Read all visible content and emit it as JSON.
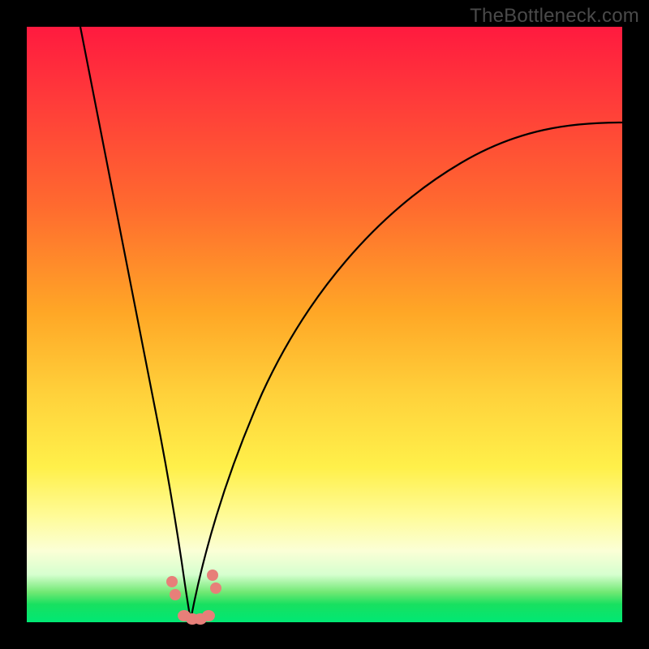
{
  "watermark": "TheBottleneck.com",
  "colors": {
    "background": "#000000",
    "curve": "#000000",
    "marker": "#e77f79"
  },
  "chart_data": {
    "type": "line",
    "title": "",
    "xlabel": "",
    "ylabel": "",
    "xlim": [
      0,
      100
    ],
    "ylim": [
      0,
      100
    ],
    "series": [
      {
        "name": "left-branch",
        "x": [
          9,
          12,
          15,
          17,
          19,
          21,
          22.5,
          24,
          25.5,
          27
        ],
        "values": [
          100,
          82,
          63,
          48,
          35,
          23,
          15,
          8,
          3,
          0
        ]
      },
      {
        "name": "right-branch",
        "x": [
          27,
          30,
          34,
          40,
          48,
          58,
          70,
          84,
          100
        ],
        "values": [
          0,
          8,
          20,
          35,
          50,
          62,
          72,
          79.5,
          84
        ]
      }
    ],
    "markers": [
      {
        "name": "left-cluster",
        "x": 24.3,
        "y": 6.5
      },
      {
        "name": "left-cluster",
        "x": 24.9,
        "y": 4.2
      },
      {
        "name": "floor-cluster",
        "x": 26.0,
        "y": 0.9
      },
      {
        "name": "floor-cluster",
        "x": 27.4,
        "y": 0.6
      },
      {
        "name": "floor-cluster",
        "x": 28.8,
        "y": 0.6
      },
      {
        "name": "floor-cluster",
        "x": 30.2,
        "y": 0.9
      },
      {
        "name": "right-cluster",
        "x": 31.0,
        "y": 7.8
      },
      {
        "name": "right-cluster",
        "x": 31.6,
        "y": 5.6
      }
    ],
    "gradient_bands_pct": [
      {
        "label": "red",
        "from": 0,
        "to": 18
      },
      {
        "label": "orange",
        "from": 18,
        "to": 52
      },
      {
        "label": "yellow",
        "from": 52,
        "to": 80
      },
      {
        "label": "pale",
        "from": 80,
        "to": 93
      },
      {
        "label": "green",
        "from": 93,
        "to": 100
      }
    ]
  }
}
